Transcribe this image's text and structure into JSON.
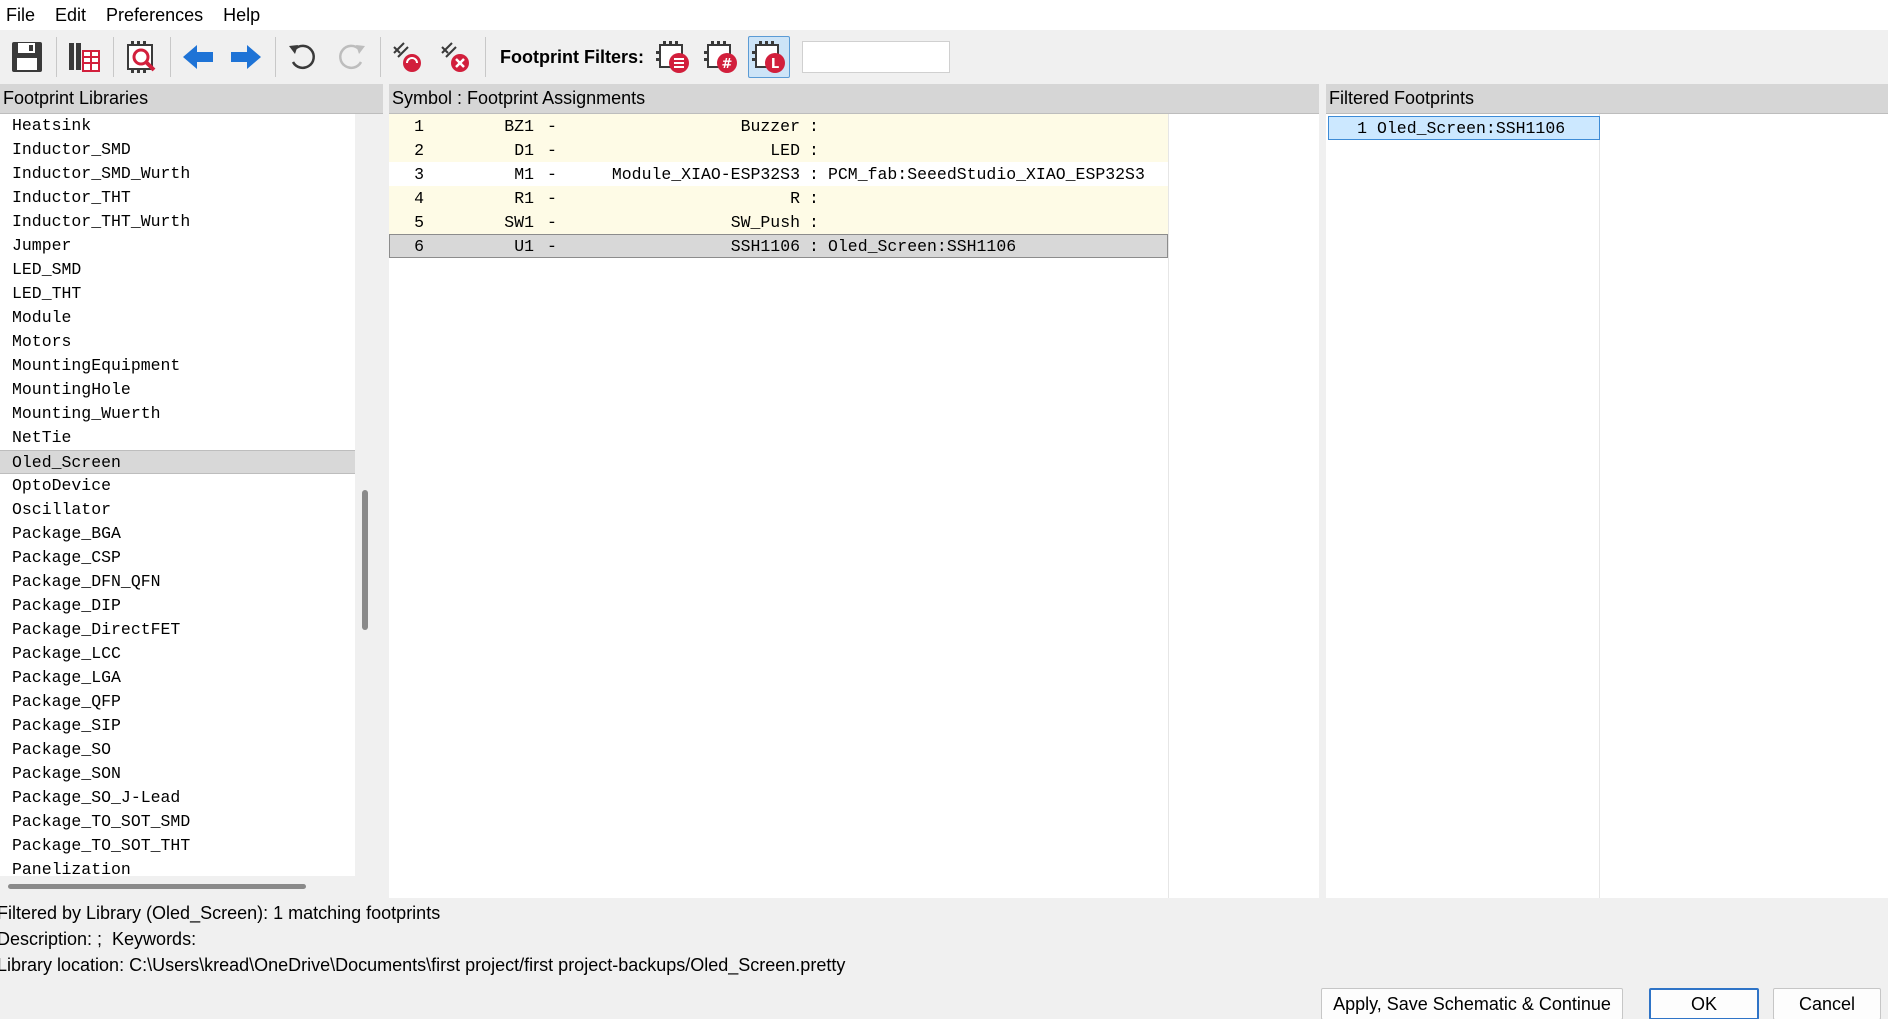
{
  "menu": [
    "File",
    "Edit",
    "Preferences",
    "Help"
  ],
  "toolbar": {
    "filters_label": "Footprint Filters:",
    "search_value": ""
  },
  "libraries": {
    "header": "Footprint Libraries",
    "items": [
      "Heatsink",
      "Inductor_SMD",
      "Inductor_SMD_Wurth",
      "Inductor_THT",
      "Inductor_THT_Wurth",
      "Jumper",
      "LED_SMD",
      "LED_THT",
      "Module",
      "Motors",
      "MountingEquipment",
      "MountingHole",
      "Mounting_Wuerth",
      "NetTie",
      "Oled_Screen",
      "OptoDevice",
      "Oscillator",
      "Package_BGA",
      "Package_CSP",
      "Package_DFN_QFN",
      "Package_DIP",
      "Package_DirectFET",
      "Package_LCC",
      "Package_LGA",
      "Package_QFP",
      "Package_SIP",
      "Package_SO",
      "Package_SON",
      "Package_SO_J-Lead",
      "Package_TO_SOT_SMD",
      "Package_TO_SOT_THT",
      "Panelization"
    ],
    "selected": "Oled_Screen"
  },
  "assignments": {
    "header": "Symbol : Footprint Assignments",
    "rows": [
      {
        "num": "1",
        "ref": "BZ1",
        "dash": "-",
        "value": "Buzzer",
        "sep": ":",
        "footprint": "",
        "state": "unassigned"
      },
      {
        "num": "2",
        "ref": "D1",
        "dash": "-",
        "value": "LED",
        "sep": ":",
        "footprint": "",
        "state": "unassigned"
      },
      {
        "num": "3",
        "ref": "M1",
        "dash": "-",
        "value": "Module_XIAO-ESP32S3",
        "sep": ":",
        "footprint": "PCM_fab:SeeedStudio_XIAO_ESP32S3",
        "state": "assigned"
      },
      {
        "num": "4",
        "ref": "R1",
        "dash": "-",
        "value": "R",
        "sep": ":",
        "footprint": "",
        "state": "unassigned"
      },
      {
        "num": "5",
        "ref": "SW1",
        "dash": "-",
        "value": "SW_Push",
        "sep": ":",
        "footprint": "",
        "state": "unassigned"
      },
      {
        "num": "6",
        "ref": "U1",
        "dash": "-",
        "value": "SSH1106",
        "sep": ":",
        "footprint": "Oled_Screen:SSH1106",
        "state": "selected"
      }
    ]
  },
  "filtered": {
    "header": "Filtered Footprints",
    "items": [
      {
        "num": "1",
        "name": "Oled_Screen:SSH1106"
      }
    ]
  },
  "status": {
    "line1": "Filtered by Library (Oled_Screen): 1 matching footprints",
    "line2": "Description: ;  Keywords:",
    "line3": "Library location: C:\\Users\\kread\\OneDrive\\Documents\\first project/first project-backups/Oled_Screen.pretty"
  },
  "buttons": {
    "apply": "Apply, Save Schematic & Continue",
    "ok": "OK",
    "cancel": "Cancel"
  },
  "colors": {
    "unassigned_row": "#fefbe6",
    "selected_row": "#d8d8d8",
    "accent_blue": "#1e73d6",
    "icon_red": "#d21f3c"
  }
}
